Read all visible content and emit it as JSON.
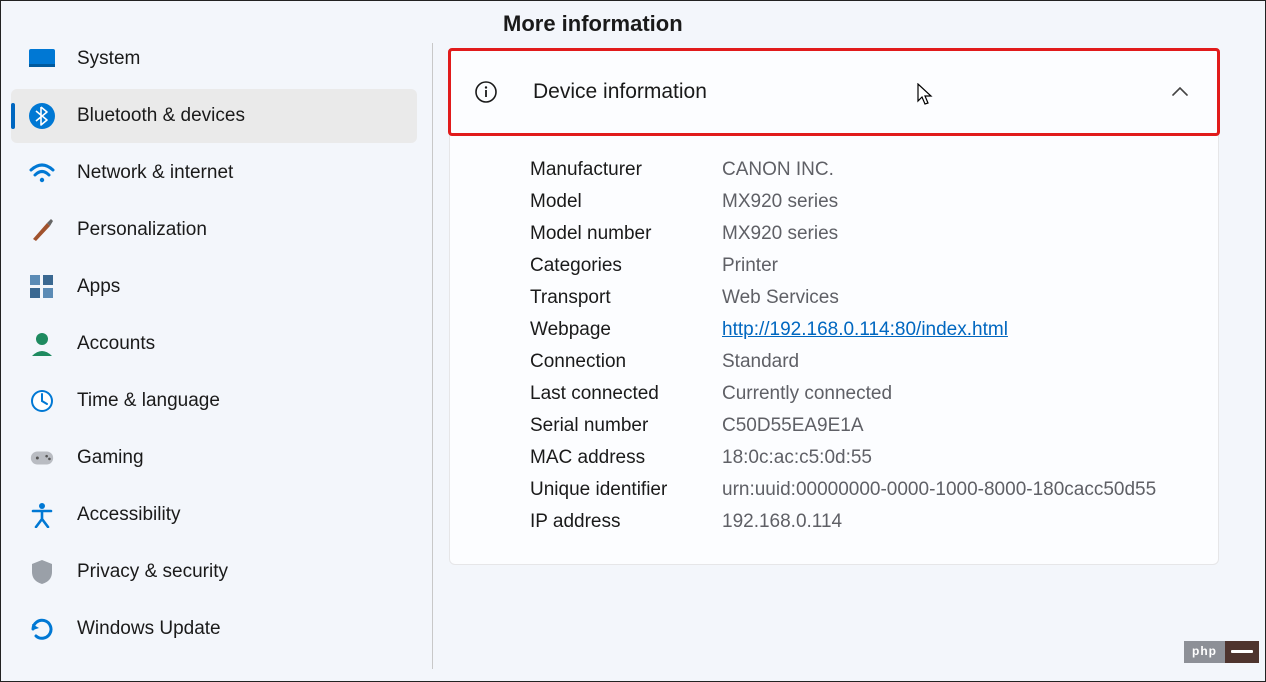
{
  "sidebar": {
    "items": [
      {
        "label": "System",
        "icon": "system"
      },
      {
        "label": "Bluetooth & devices",
        "icon": "bluetooth",
        "selected": true
      },
      {
        "label": "Network & internet",
        "icon": "wifi"
      },
      {
        "label": "Personalization",
        "icon": "brush"
      },
      {
        "label": "Apps",
        "icon": "apps"
      },
      {
        "label": "Accounts",
        "icon": "account"
      },
      {
        "label": "Time & language",
        "icon": "clock"
      },
      {
        "label": "Gaming",
        "icon": "game"
      },
      {
        "label": "Accessibility",
        "icon": "accessibility"
      },
      {
        "label": "Privacy & security",
        "icon": "shield"
      },
      {
        "label": "Windows Update",
        "icon": "update"
      }
    ]
  },
  "main": {
    "section_title": "More information",
    "card_title": "Device information",
    "rows": [
      {
        "label": "Manufacturer",
        "value": "CANON INC."
      },
      {
        "label": "Model",
        "value": "MX920 series"
      },
      {
        "label": "Model number",
        "value": "MX920 series"
      },
      {
        "label": "Categories",
        "value": "Printer"
      },
      {
        "label": "Transport",
        "value": "Web Services"
      },
      {
        "label": "Webpage",
        "value": "http://192.168.0.114:80/index.html",
        "link": true
      },
      {
        "label": "Connection",
        "value": "Standard"
      },
      {
        "label": "Last connected",
        "value": "Currently connected"
      },
      {
        "label": "Serial number",
        "value": "C50D55EA9E1A"
      },
      {
        "label": "MAC address",
        "value": "18:0c:ac:c5:0d:55"
      },
      {
        "label": "Unique identifier",
        "value": "urn:uuid:00000000-0000-1000-8000-180cacc50d55"
      },
      {
        "label": "IP address",
        "value": "192.168.0.114"
      }
    ]
  },
  "badge": {
    "text": "php"
  }
}
